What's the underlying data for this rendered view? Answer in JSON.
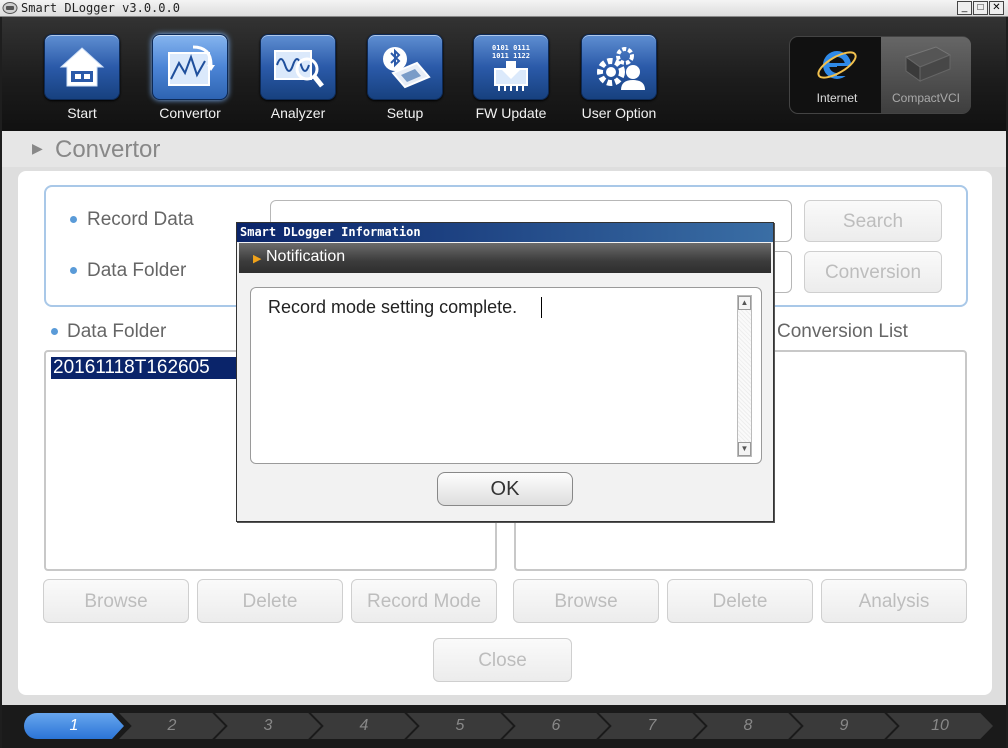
{
  "window": {
    "title": "Smart DLogger v3.0.0.0",
    "minimize_label": "_",
    "maximize_label": "□",
    "close_label": "✕"
  },
  "toolbar": {
    "items": [
      {
        "label": "Start",
        "icon": "home-icon",
        "active": false
      },
      {
        "label": "Convertor",
        "icon": "convertor-icon",
        "active": true
      },
      {
        "label": "Analyzer",
        "icon": "analyzer-icon",
        "active": false
      },
      {
        "label": "Setup",
        "icon": "setup-icon",
        "active": false
      },
      {
        "label": "FW Update",
        "icon": "fw-update-icon",
        "active": false
      },
      {
        "label": "User Option",
        "icon": "user-option-icon",
        "active": false
      }
    ],
    "firmware_icon_text": "0101 0111\n1011 1122",
    "external": [
      {
        "label": "Internet",
        "icon": "internet-explorer-icon",
        "enabled": true
      },
      {
        "label": "CompactVCI",
        "icon": "compactvci-icon",
        "enabled": false
      }
    ]
  },
  "section": {
    "title": "Convertor"
  },
  "record": {
    "record_data_label": "Record Data",
    "data_folder_label": "Data Folder",
    "record_data_value": "",
    "data_folder_value": "",
    "search_button": "Search",
    "conversion_button": "Conversion"
  },
  "lists": {
    "data_folder_title": "Data Folder",
    "data_folder_items": [
      "20161118T162605"
    ],
    "conversion_list_title": "Conversion List",
    "left_buttons": [
      "Browse",
      "Delete",
      "Record Mode"
    ],
    "right_buttons": [
      "Browse",
      "Delete",
      "Analysis"
    ],
    "close_button": "Close"
  },
  "steps": {
    "labels": [
      "1",
      "2",
      "3",
      "4",
      "5",
      "6",
      "7",
      "8",
      "9",
      "10"
    ],
    "active_index": 0
  },
  "dialog": {
    "title": "Smart DLogger Information",
    "header": "Notification",
    "message": "Record mode setting complete.",
    "ok_button": "OK"
  },
  "colors": {
    "accent_blue": "#2b5aa9",
    "selection": "#0a246a",
    "notification_arrow": "#f0a21a"
  }
}
